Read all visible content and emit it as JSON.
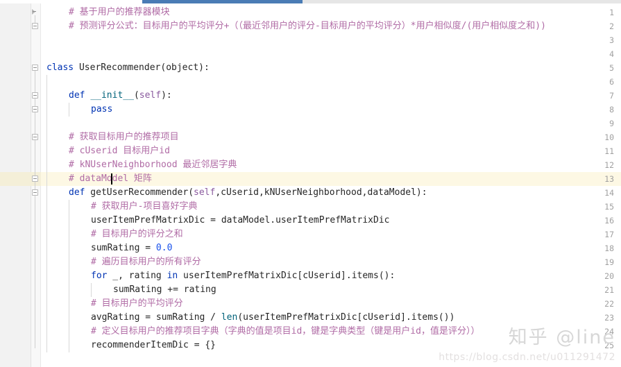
{
  "editor": {
    "app": "pycharm-code-editor",
    "language": "python",
    "background_color": "#ffffff",
    "gutter_color": "#f2f2f2",
    "current_line_color": "#fdf8e4",
    "caret_line_number": 13
  },
  "scrollbar": {
    "name": "horizontal-scrollbar",
    "thumb_color": "#4a7cb5",
    "track_color": "#e6e6e6"
  },
  "line_numbers": [
    "1",
    "2",
    "3",
    "4",
    "5",
    "6",
    "7",
    "8",
    "9",
    "10",
    "11",
    "12",
    "13",
    "14",
    "15",
    "16",
    "17",
    "18",
    "19",
    "20",
    "21",
    "22",
    "23",
    "24",
    "25"
  ],
  "lines": [
    {
      "n": "1",
      "indent": 4,
      "tokens": [
        {
          "t": "# 基于用户的推荐器模块",
          "c": "com"
        }
      ]
    },
    {
      "n": "2",
      "indent": 4,
      "tokens": [
        {
          "t": "# 预测评分公式：目标用户的平均评分+（（最近邻用户的评分-目标用户的平均评分）*用户相似度/(用户相似度之和))",
          "c": "com"
        }
      ]
    },
    {
      "n": "3",
      "indent": 0,
      "tokens": []
    },
    {
      "n": "4",
      "indent": 0,
      "tokens": []
    },
    {
      "n": "5",
      "indent": 0,
      "tokens": [
        {
          "t": "class",
          "c": "kw"
        },
        {
          "t": " UserRecommender(object):",
          "c": "plain"
        }
      ]
    },
    {
      "n": "6",
      "indent": 0,
      "tokens": []
    },
    {
      "n": "7",
      "indent": 4,
      "tokens": [
        {
          "t": "def",
          "c": "kw"
        },
        {
          "t": " ",
          "c": "plain"
        },
        {
          "t": "__init__",
          "c": "fn"
        },
        {
          "t": "(",
          "c": "plain"
        },
        {
          "t": "self",
          "c": "self"
        },
        {
          "t": "):",
          "c": "plain"
        }
      ]
    },
    {
      "n": "8",
      "indent": 8,
      "tokens": [
        {
          "t": "pass",
          "c": "kw"
        }
      ]
    },
    {
      "n": "9",
      "indent": 0,
      "tokens": []
    },
    {
      "n": "10",
      "indent": 4,
      "tokens": [
        {
          "t": "# 获取目标用户的推荐项目",
          "c": "com"
        }
      ]
    },
    {
      "n": "11",
      "indent": 4,
      "tokens": [
        {
          "t": "# cUserid 目标用户id",
          "c": "com"
        }
      ]
    },
    {
      "n": "12",
      "indent": 4,
      "tokens": [
        {
          "t": "# kNUserNeighborhood 最近邻居字典",
          "c": "com"
        }
      ]
    },
    {
      "n": "13",
      "indent": 4,
      "tokens": [
        {
          "t": "# dataModel 矩阵",
          "c": "com"
        }
      ]
    },
    {
      "n": "14",
      "indent": 4,
      "tokens": [
        {
          "t": "def",
          "c": "kw"
        },
        {
          "t": " getUserRecommender(",
          "c": "plain"
        },
        {
          "t": "self",
          "c": "self"
        },
        {
          "t": ",cUserid,kNUserNeighborhood,dataModel):",
          "c": "plain"
        }
      ]
    },
    {
      "n": "15",
      "indent": 8,
      "tokens": [
        {
          "t": "# 获取用户-项目喜好字典",
          "c": "com"
        }
      ]
    },
    {
      "n": "16",
      "indent": 8,
      "tokens": [
        {
          "t": "userItemPrefMatrixDic = dataModel.userItemPrefMatrixDic",
          "c": "plain"
        }
      ]
    },
    {
      "n": "17",
      "indent": 8,
      "tokens": [
        {
          "t": "# 目标用户的评分之和",
          "c": "com"
        }
      ]
    },
    {
      "n": "18",
      "indent": 8,
      "tokens": [
        {
          "t": "sumRating = ",
          "c": "plain"
        },
        {
          "t": "0.0",
          "c": "num"
        }
      ]
    },
    {
      "n": "19",
      "indent": 8,
      "tokens": [
        {
          "t": "# 遍历目标用户的所有评分",
          "c": "com"
        }
      ]
    },
    {
      "n": "20",
      "indent": 8,
      "tokens": [
        {
          "t": "for",
          "c": "kw"
        },
        {
          "t": " _, rating ",
          "c": "plain"
        },
        {
          "t": "in",
          "c": "kw"
        },
        {
          "t": " userItemPrefMatrixDic[cUserid].items():",
          "c": "plain"
        }
      ]
    },
    {
      "n": "21",
      "indent": 12,
      "tokens": [
        {
          "t": "sumRating += rating",
          "c": "plain"
        }
      ]
    },
    {
      "n": "22",
      "indent": 8,
      "tokens": [
        {
          "t": "# 目标用户的平均评分",
          "c": "com"
        }
      ]
    },
    {
      "n": "23",
      "indent": 8,
      "tokens": [
        {
          "t": "avgRating = sumRating / ",
          "c": "plain"
        },
        {
          "t": "len",
          "c": "fn"
        },
        {
          "t": "(userItemPrefMatrixDic[cUserid].items())",
          "c": "plain"
        }
      ]
    },
    {
      "n": "24",
      "indent": 8,
      "tokens": [
        {
          "t": "# 定义目标用户的推荐项目字典（字典的值是项目id，键是字典类型（键是用户id，值是评分））",
          "c": "com"
        }
      ]
    },
    {
      "n": "25",
      "indent": 8,
      "tokens": [
        {
          "t": "recommenderItemDic = {}",
          "c": "plain"
        }
      ]
    }
  ],
  "watermark": {
    "zhihu": "知乎 @line",
    "csdn": "https://blog.csdn.net/u011291472"
  }
}
